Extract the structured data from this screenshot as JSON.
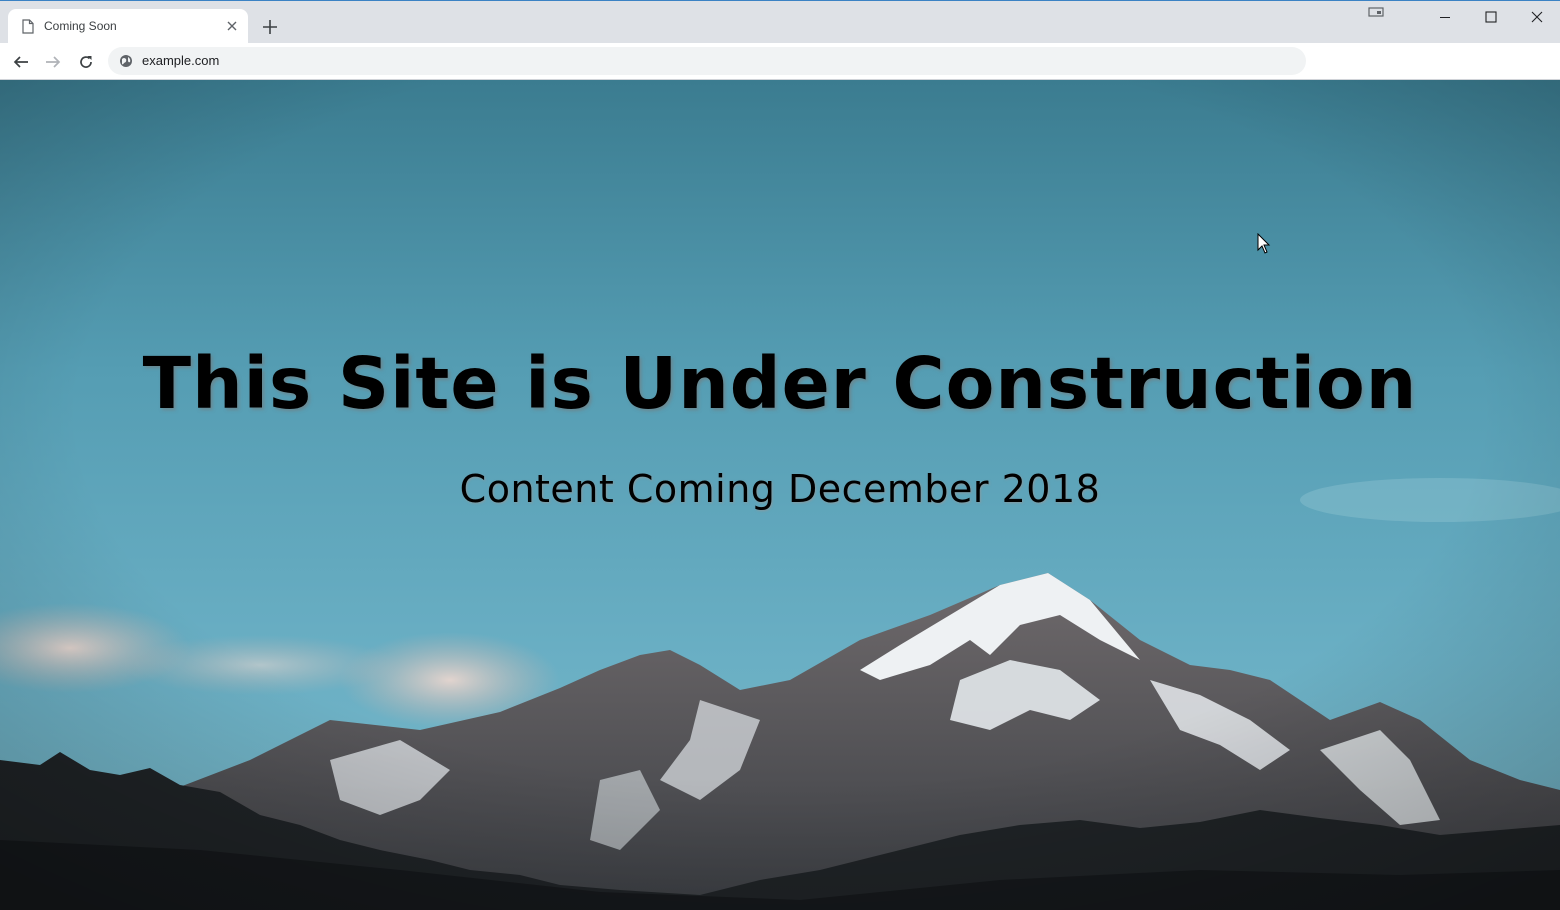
{
  "browser": {
    "tab_title": "Coming Soon",
    "url": "example.com",
    "accent_color": "#3b82c4"
  },
  "icons": {
    "favicon": "page-icon",
    "tab_close": "close-icon",
    "new_tab": "plus-icon",
    "back": "arrow-left-icon",
    "forward": "arrow-right-icon",
    "reload": "reload-icon",
    "site_info": "globe-icon",
    "cast": "cast-icon",
    "minimize": "minimize-icon",
    "maximize": "maximize-icon",
    "close": "close-icon"
  },
  "page": {
    "headline": "This Site is Under Construction",
    "subline": "Content Coming December 2018",
    "sky_color_top": "#3d7f93",
    "sky_color_mid": "#5ea3b8"
  }
}
